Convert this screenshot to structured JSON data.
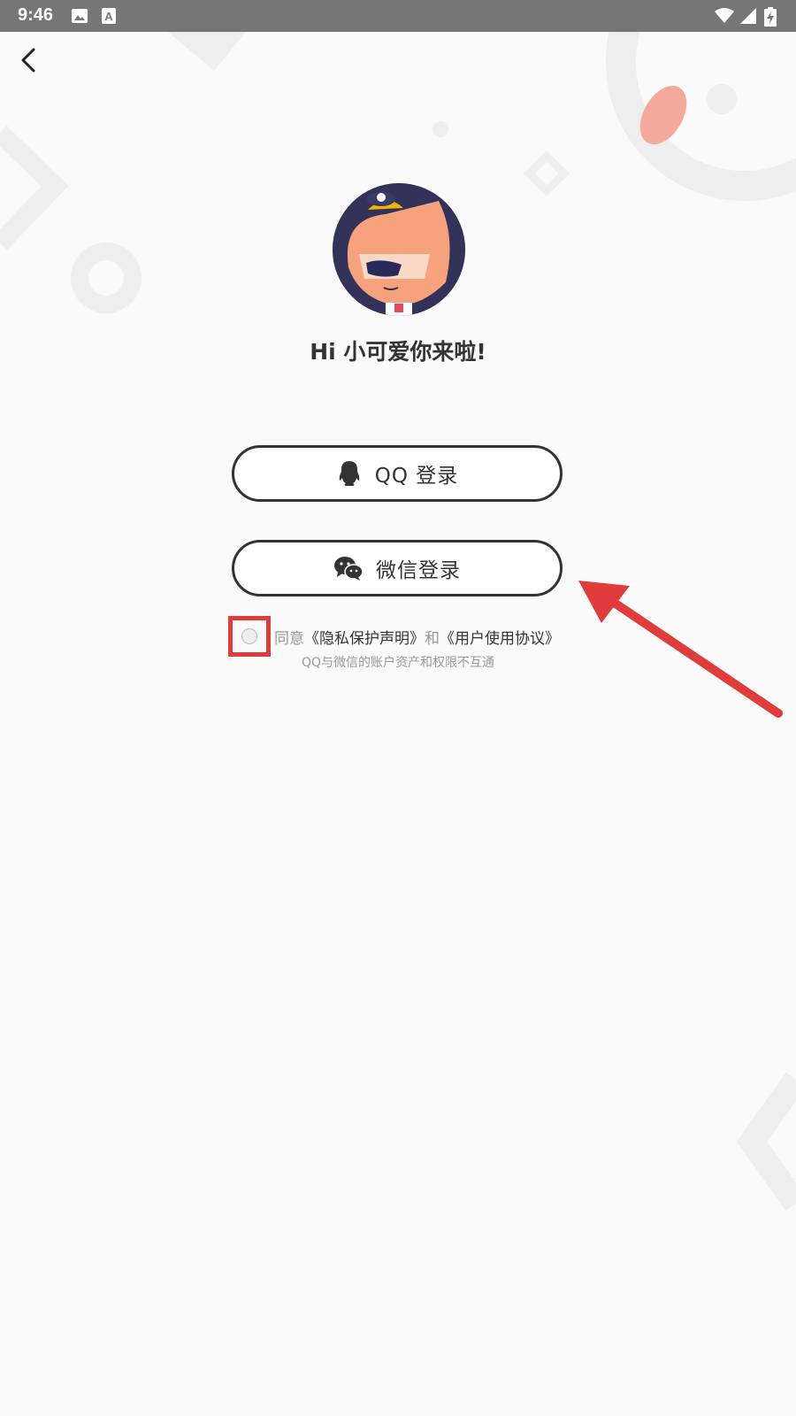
{
  "status_bar": {
    "time": "9:46",
    "icons": [
      "image-icon",
      "text-a-icon",
      "wifi-icon",
      "signal-icon",
      "battery-charging-icon"
    ]
  },
  "navigation": {
    "back_icon": "chevron-left-icon"
  },
  "greeting": "Hi 小可爱你来啦!",
  "login": {
    "qq_label": "QQ 登录",
    "qq_icon": "qq-penguin-icon",
    "wechat_label": "微信登录",
    "wechat_icon": "wechat-icon"
  },
  "agreement": {
    "prefix": "同意",
    "privacy_link": "《隐私保护声明》",
    "conjunction": "和",
    "terms_link": "《用户使用协议》",
    "checked": false
  },
  "note": "QQ与微信的账户资产和权限不互通",
  "colors": {
    "status_bar": "#767676",
    "text_primary": "#333333",
    "text_secondary": "#999999",
    "highlight_red": "#e13c3c",
    "deco_orange": "#f5a99a"
  }
}
